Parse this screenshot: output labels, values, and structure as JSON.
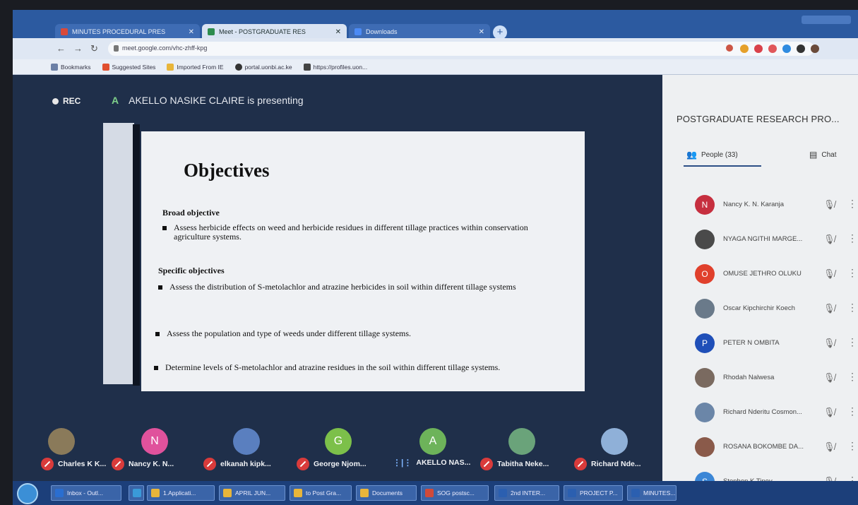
{
  "browser": {
    "tabs": [
      {
        "label": "MINUTES PROCEDURAL PRES",
        "active": false,
        "color": "#d94a3a"
      },
      {
        "label": "Meet - POSTGRADUATE RES",
        "active": true,
        "color": "#2d8c4e"
      },
      {
        "label": "Downloads",
        "active": false,
        "color": "#4c8bf5"
      }
    ],
    "new_tab": "+",
    "url": "meet.google.com/vhc-zhff-kpg",
    "bookmarks": [
      {
        "label": "Bookmarks",
        "color": "#6b7fa6"
      },
      {
        "label": "Suggested Sites",
        "color": "#e04f2f"
      },
      {
        "label": "Imported From IE",
        "color": "#e8b53a"
      },
      {
        "label": "portal.uonbi.ac.ke",
        "color": "#333333"
      },
      {
        "label": "https://profiles.uon...",
        "color": "#444444"
      }
    ]
  },
  "meet": {
    "rec_label": "REC",
    "presenter_initial": "A",
    "presenter_text": "AKELLO NASIKE CLAIRE is presenting"
  },
  "slide": {
    "title": "Objectives",
    "broad_heading": "Broad objective",
    "broad_items": [
      "Assess herbicide effects on weed and herbicide residues in different tillage practices within conservation agriculture systems."
    ],
    "specific_heading": "Specific objectives",
    "specific_items": [
      "Assess the distribution of S-metolachlor and atrazine herbicides in soil within different tillage systems",
      "Assess the population and type of weeds under different tillage systems.",
      "Determine levels of S-metolachlor and atrazine  residues in the soil within different tillage systems."
    ]
  },
  "participants_strip": [
    {
      "name": "Charles K K...",
      "initial": "",
      "color": "#8a7a5a",
      "muted": true
    },
    {
      "name": "Nancy K. N...",
      "initial": "N",
      "color": "#e0529c",
      "muted": true
    },
    {
      "name": "elkanah kipk...",
      "initial": "",
      "color": "#5a7fbf",
      "muted": true
    },
    {
      "name": "George Njom...",
      "initial": "G",
      "color": "#7cc04a",
      "muted": true
    },
    {
      "name": "AKELLO NAS...",
      "initial": "A",
      "color": "#6db35a",
      "muted": false
    },
    {
      "name": "Tabitha Neke...",
      "initial": "",
      "color": "#6aa37a",
      "muted": true
    },
    {
      "name": "Richard Nde...",
      "initial": "",
      "color": "#8fb0d8",
      "muted": true
    }
  ],
  "panel": {
    "title": "POSTGRADUATE RESEARCH PRO...",
    "people_tab": "People (33)",
    "chat_tab": "Chat",
    "people": [
      {
        "name": "Nancy K. N. Karanja",
        "initial": "N",
        "color": "#c62f3f"
      },
      {
        "name": "NYAGA NGITHI MARGE...",
        "initial": "",
        "color": "#4a4a4a"
      },
      {
        "name": "OMUSE JETHRO OLUKU",
        "initial": "O",
        "color": "#e0402c"
      },
      {
        "name": "Oscar Kipchirchir Koech",
        "initial": "",
        "color": "#6a7a8a"
      },
      {
        "name": "PETER N OMBITA",
        "initial": "P",
        "color": "#1f4fb8"
      },
      {
        "name": "Rhodah Nalwesa",
        "initial": "",
        "color": "#7a6a60"
      },
      {
        "name": "Richard Nderitu Cosmon...",
        "initial": "",
        "color": "#6b86a8"
      },
      {
        "name": "ROSANA BOKOMBE DA...",
        "initial": "",
        "color": "#8a5a4a"
      },
      {
        "name": "Stephen K Tinoy",
        "initial": "S",
        "color": "#3b86d6"
      }
    ]
  },
  "taskbar": {
    "items": [
      {
        "label": "Inbox - Outl...",
        "color": "#2a6ed0"
      },
      {
        "label": "",
        "color": "#3a9ad8"
      },
      {
        "label": "1.Applicati...",
        "color": "#e8b53a"
      },
      {
        "label": "APRIL JUN...",
        "color": "#e8b53a"
      },
      {
        "label": "to Post Gra...",
        "color": "#e8b53a"
      },
      {
        "label": "Documents",
        "color": "#e8b53a"
      },
      {
        "label": "SOG postsc...",
        "color": "#d04a3a"
      },
      {
        "label": "2nd INTER...",
        "color": "#2b5fb0"
      },
      {
        "label": "PROJECT P...",
        "color": "#2b5fb0"
      },
      {
        "label": "MINUTES...",
        "color": "#2b5fb0"
      }
    ]
  }
}
